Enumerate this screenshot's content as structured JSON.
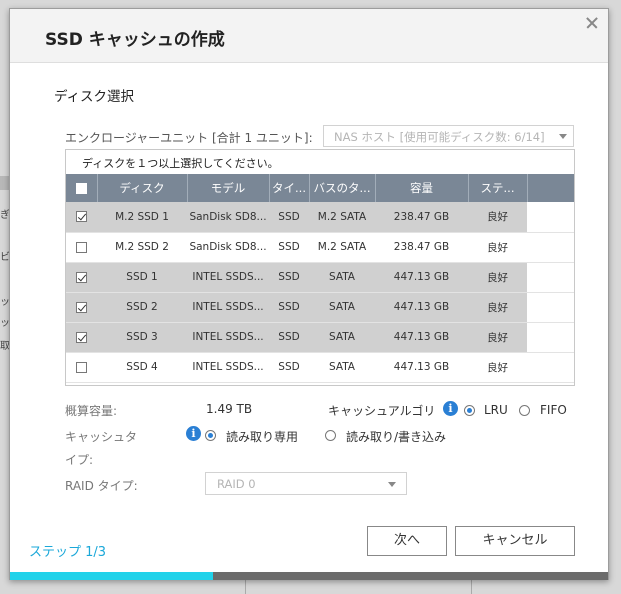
{
  "background": {
    "fragments": [
      "ぎ",
      "ビ",
      "ッ",
      "ッ",
      "取"
    ]
  },
  "dialog": {
    "title": "SSD キャッシュの作成",
    "section_title": "ディスク選択",
    "enclosure": {
      "label": "エンクロージャーユニット [合計 1 ユニット]:",
      "value": "NAS ホスト [使用可能ディスク数: 6/14]"
    },
    "disk_list": {
      "instruction": "ディスクを１つ以上選択してください。",
      "columns": [
        "ディスク",
        "モデル",
        "タイ...",
        "バスのタ...",
        "容量",
        "ステ..."
      ],
      "rows": [
        {
          "checked": true,
          "disk": "M.2 SSD 1",
          "model": "SanDisk SD8...",
          "type": "SSD",
          "bus": "M.2 SATA",
          "capacity": "238.47 GB",
          "status": "良好"
        },
        {
          "checked": false,
          "disk": "M.2 SSD 2",
          "model": "SanDisk SD8...",
          "type": "SSD",
          "bus": "M.2 SATA",
          "capacity": "238.47 GB",
          "status": "良好"
        },
        {
          "checked": true,
          "disk": "SSD 1",
          "model": "INTEL SSDS...",
          "type": "SSD",
          "bus": "SATA",
          "capacity": "447.13 GB",
          "status": "良好"
        },
        {
          "checked": true,
          "disk": "SSD 2",
          "model": "INTEL SSDS...",
          "type": "SSD",
          "bus": "SATA",
          "capacity": "447.13 GB",
          "status": "良好"
        },
        {
          "checked": true,
          "disk": "SSD 3",
          "model": "INTEL SSDS...",
          "type": "SSD",
          "bus": "SATA",
          "capacity": "447.13 GB",
          "status": "良好"
        },
        {
          "checked": false,
          "disk": "SSD 4",
          "model": "INTEL SSDS...",
          "type": "SSD",
          "bus": "SATA",
          "capacity": "447.13 GB",
          "status": "良好"
        }
      ]
    },
    "capacity": {
      "label": "概算容量:",
      "value": "1.49 TB"
    },
    "algorithm": {
      "label": "キャッシュアルゴリ",
      "options": [
        {
          "label": "LRU",
          "selected": true
        },
        {
          "label": "FIFO",
          "selected": false
        }
      ]
    },
    "cache_type": {
      "label_line1": "キャッシュタ",
      "label_line2": "イプ:",
      "options": [
        {
          "label": "読み取り専用",
          "selected": true
        },
        {
          "label": "読み取り/書き込み",
          "selected": false
        }
      ]
    },
    "raid": {
      "label": "RAID タイプ:",
      "value": "RAID 0"
    },
    "footer": {
      "step": "ステップ 1/3",
      "next_label": "次へ",
      "cancel_label": "キャンセル",
      "progress": 0.34
    },
    "colors": {
      "accent": "#1ba8d9",
      "progress": "#21d2ea",
      "header_bg": "#7a8796",
      "info": "#2a7fd4"
    }
  }
}
